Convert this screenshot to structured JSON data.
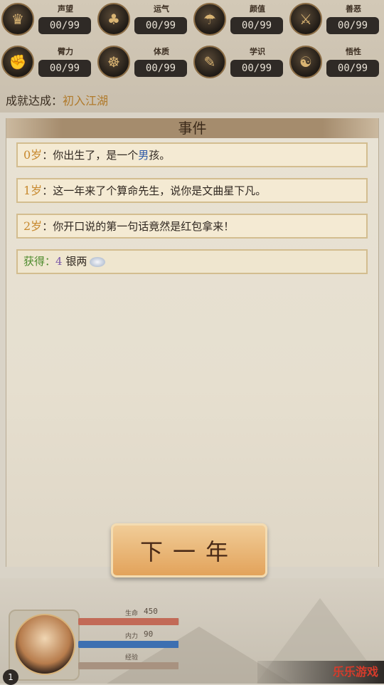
{
  "stats": [
    {
      "label": "声望",
      "value": "00/99",
      "icon": "reputation-icon",
      "glyph": "♛"
    },
    {
      "label": "运气",
      "value": "00/99",
      "icon": "luck-icon",
      "glyph": "♣"
    },
    {
      "label": "颜值",
      "value": "00/99",
      "icon": "looks-icon",
      "glyph": "☂"
    },
    {
      "label": "善恶",
      "value": "00/99",
      "icon": "morality-icon",
      "glyph": "⚔"
    },
    {
      "label": "臂力",
      "value": "00/99",
      "icon": "strength-icon",
      "glyph": "✊"
    },
    {
      "label": "体质",
      "value": "00/99",
      "icon": "constitution-icon",
      "glyph": "☸"
    },
    {
      "label": "学识",
      "value": "00/99",
      "icon": "knowledge-icon",
      "glyph": "✎"
    },
    {
      "label": "悟性",
      "value": "00/99",
      "icon": "comprehension-icon",
      "glyph": "☯"
    }
  ],
  "achievement": {
    "prefix": "成就达成：",
    "title": "初入江湖"
  },
  "panel_title": "事件",
  "events": [
    {
      "age": "0岁",
      "sep": "：",
      "text_pre": "你出生了，是一个",
      "highlight": "男",
      "text_post": "孩。"
    },
    {
      "age": "1岁",
      "sep": "：",
      "text": "这一年来了个算命先生，说你是文曲星下凡。"
    },
    {
      "age": "2岁",
      "sep": "：",
      "text": "你开口说的第一句话竟然是红包拿来！"
    }
  ],
  "gain": {
    "label": "获得",
    "sep": "：",
    "amount": "4",
    "item": "银两",
    "icon": "silver-tael-icon"
  },
  "next_button": "下一年",
  "player": {
    "level": "1",
    "bars": [
      {
        "label": "生命",
        "value": "450",
        "fill": 0.99,
        "color": "#c26a57"
      },
      {
        "label": "内力",
        "value": "90",
        "fill": 0.99,
        "color": "#3d6fb1"
      },
      {
        "label": "经验",
        "value": "",
        "fill": 0.99,
        "color": "#a89280"
      }
    ]
  },
  "watermark": "乐乐游戏"
}
